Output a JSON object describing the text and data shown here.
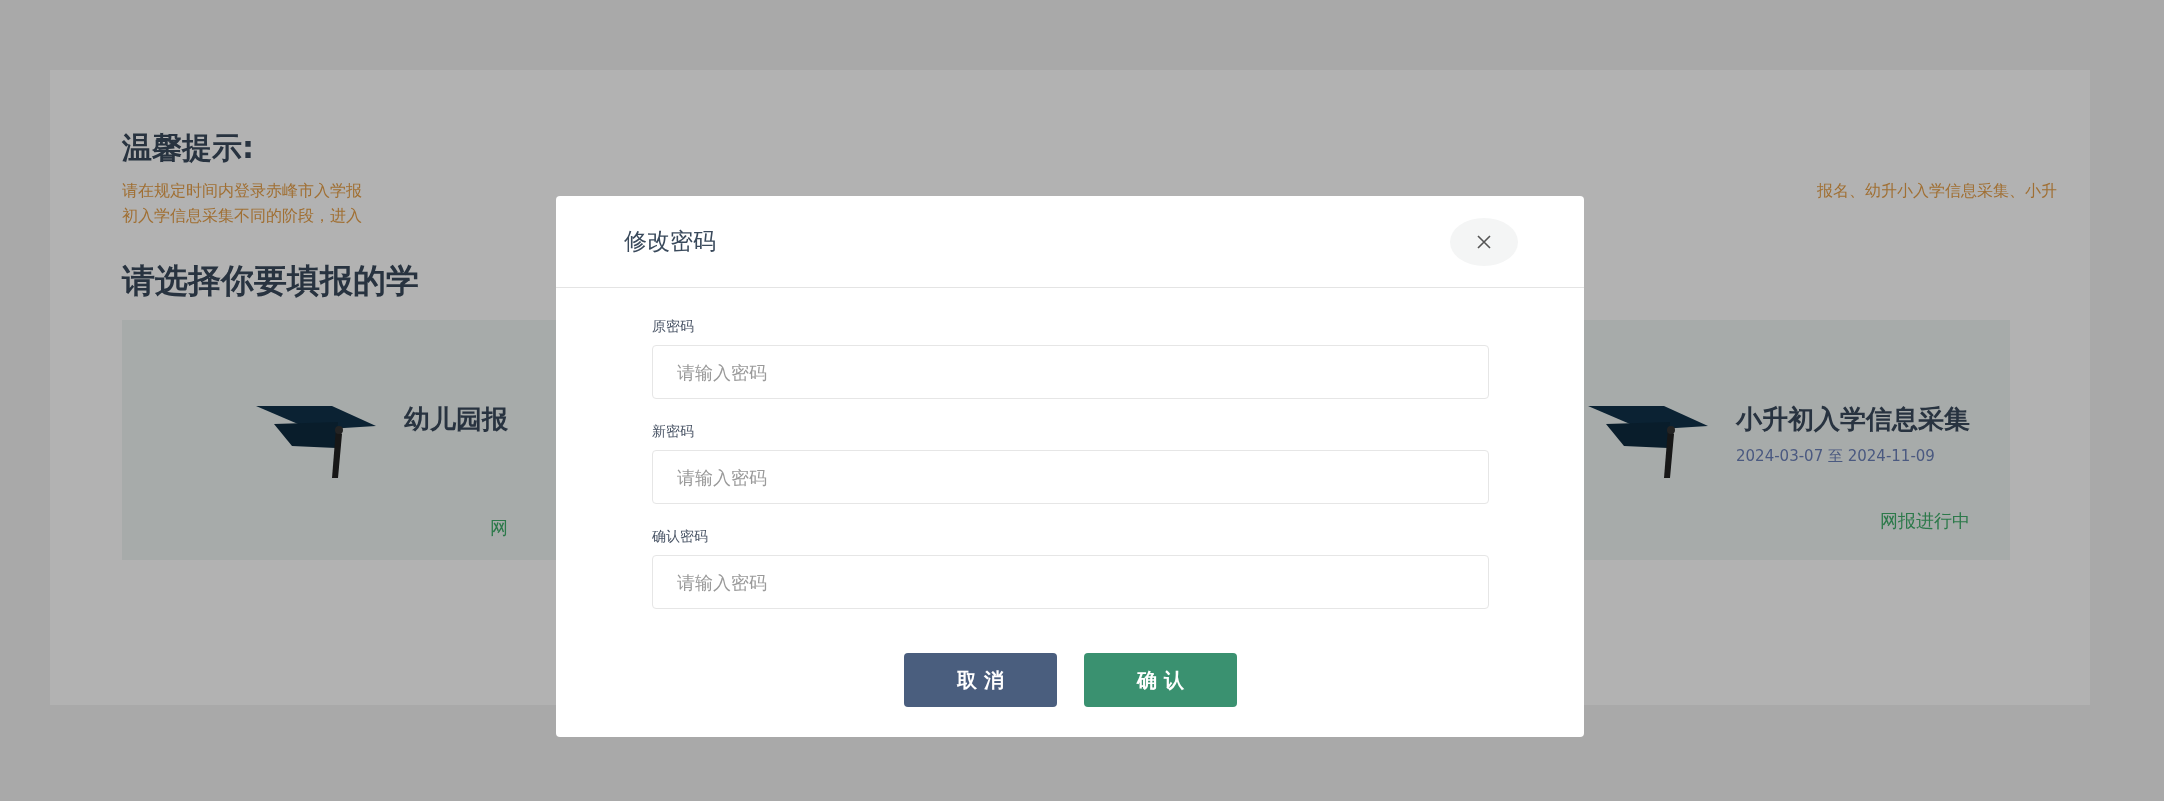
{
  "notice": {
    "title": "温馨提示:",
    "lines": [
      {
        "left": "请在规定时间内登录赤峰市入学报",
        "right": "报名、幼升小入学信息采集、小升"
      },
      {
        "left": "初入学信息采集不同的阶段，进入"
      }
    ]
  },
  "heading": "请选择你要填报的学",
  "cards": [
    {
      "title": "幼儿园报",
      "status": "网"
    },
    {
      "title": "小升初入学信息采集",
      "date": "2024-03-07 至 2024-11-09",
      "status": "网报进行中"
    }
  ],
  "modal": {
    "title": "修改密码",
    "fields": [
      {
        "label": "原密码",
        "placeholder": "请输入密码"
      },
      {
        "label": "新密码",
        "placeholder": "请输入密码"
      },
      {
        "label": "确认密码",
        "placeholder": "请输入密码"
      }
    ],
    "buttons": [
      {
        "label": "取 消",
        "kind": "cancel"
      },
      {
        "label": "确 认",
        "kind": "confirm"
      }
    ]
  }
}
